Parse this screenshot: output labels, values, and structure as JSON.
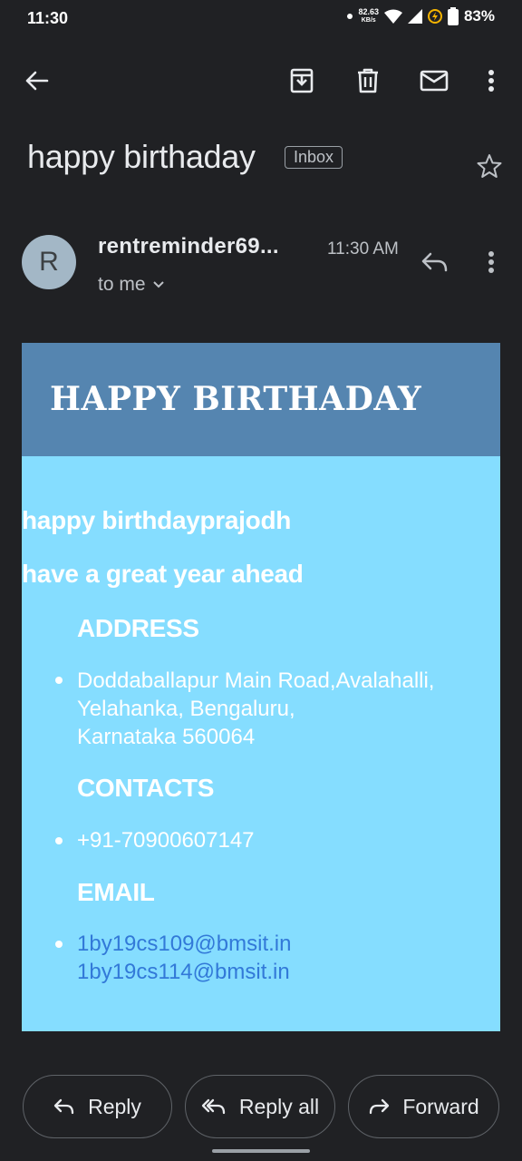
{
  "status_bar": {
    "time": "11:30",
    "net_speed_value": "82.63",
    "net_speed_unit": "KB/s",
    "battery": "83%"
  },
  "email": {
    "subject": "happy birthaday",
    "label": "Inbox",
    "sender_initial": "R",
    "sender": "rentreminder69...",
    "time": "11:30 AM",
    "recipient": "to me"
  },
  "card": {
    "title": "HAPPY BIRTHADAY",
    "greeting_line1": "happy birthdayprajodh",
    "greeting_line2": "have a great year ahead",
    "address_heading": "ADDRESS",
    "address_line1": "Doddaballapur Main Road,Avalahalli,",
    "address_line2": "Yelahanka, Bengaluru,",
    "address_line3": "Karnataka 560064",
    "contacts_heading": "CONTACTS",
    "phone": "+91-70900607147",
    "email_heading": "EMAIL",
    "email1": "1by19cs109@bmsit.in",
    "email2": "1by19cs114@bmsit.in",
    "header_color": "#5585b0",
    "body_color": "#85ddff"
  },
  "actions": {
    "reply": "Reply",
    "reply_all": "Reply all",
    "forward": "Forward"
  },
  "icons": [
    "back-arrow-icon",
    "archive-icon",
    "delete-icon",
    "mark-unread-icon",
    "more-vert-icon",
    "star-icon",
    "reply-icon",
    "chevron-down-icon",
    "reply-all-icon",
    "forward-icon"
  ]
}
